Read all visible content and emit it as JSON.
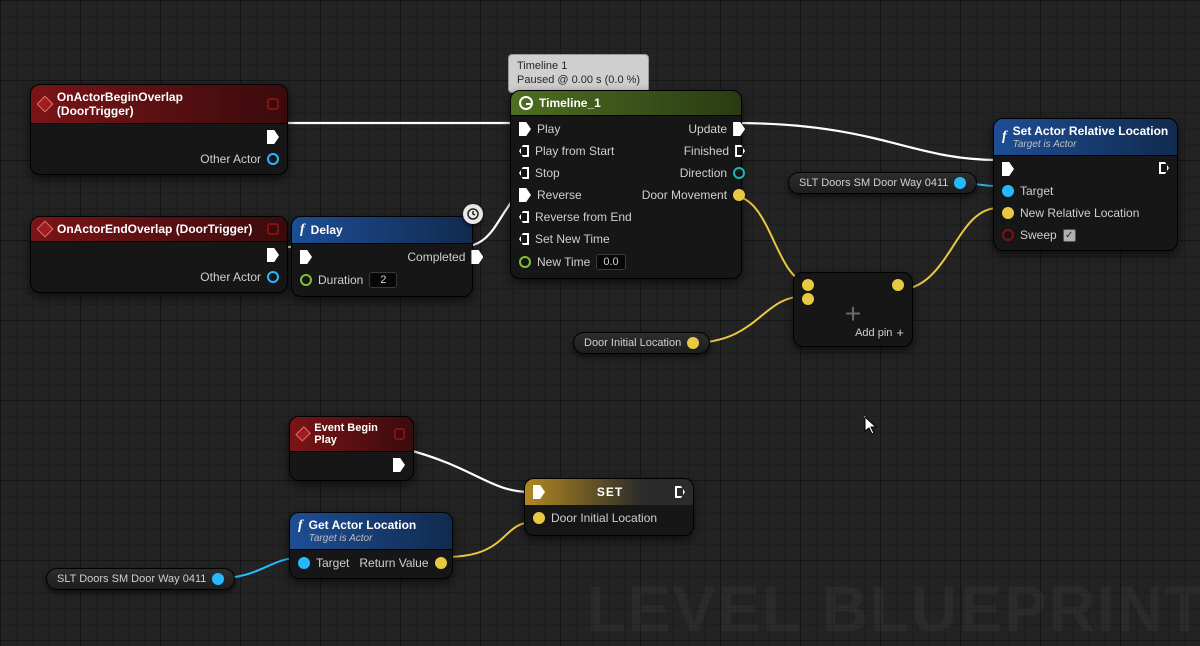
{
  "watermark": "LEVEL BLUEPRINT",
  "tooltip": {
    "line1": "Timeline 1",
    "line2": "Paused @ 0.00 s (0.0 %)"
  },
  "pills": {
    "slt_top": "SLT Doors SM Door Way 0411",
    "door_init": "Door Initial Location",
    "slt_bot": "SLT Doors SM Door Way 0411"
  },
  "nodes": {
    "begin_overlap": {
      "title": "OnActorBeginOverlap (DoorTrigger)",
      "pin_other_actor": "Other Actor"
    },
    "end_overlap": {
      "title": "OnActorEndOverlap (DoorTrigger)",
      "pin_other_actor": "Other Actor"
    },
    "delay": {
      "title": "Delay",
      "pin_duration": "Duration",
      "duration_value": "2",
      "pin_completed": "Completed"
    },
    "timeline": {
      "title": "Timeline_1",
      "pin_play": "Play",
      "pin_play_from_start": "Play from Start",
      "pin_stop": "Stop",
      "pin_reverse": "Reverse",
      "pin_reverse_from_end": "Reverse from End",
      "pin_set_new_time": "Set New Time",
      "pin_new_time": "New Time",
      "new_time_value": "0.0",
      "pin_update": "Update",
      "pin_finished": "Finished",
      "pin_direction": "Direction",
      "pin_door_movement": "Door Movement"
    },
    "add_pin": "Add pin",
    "set_loc": {
      "title": "Set Actor Relative Location",
      "subtitle": "Target is Actor",
      "pin_target": "Target",
      "pin_new_loc": "New Relative Location",
      "pin_sweep": "Sweep"
    },
    "event_begin_play": {
      "title": "Event Begin Play"
    },
    "get_actor_loc": {
      "title": "Get Actor Location",
      "subtitle": "Target is Actor",
      "pin_target": "Target",
      "pin_return": "Return Value"
    },
    "set_node": {
      "title": "SET",
      "pin_var": "Door Initial Location"
    }
  }
}
